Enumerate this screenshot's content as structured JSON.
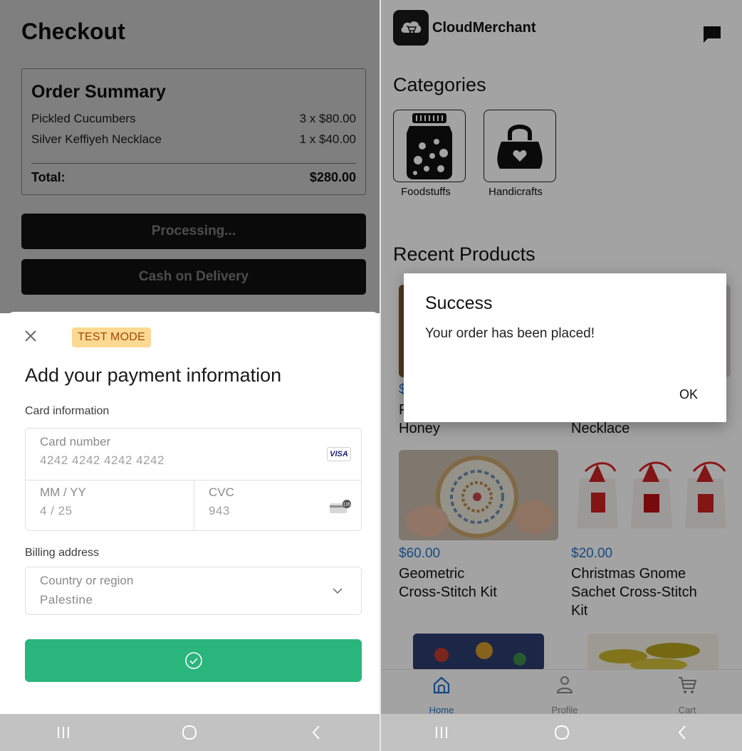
{
  "checkout": {
    "title": "Checkout",
    "summary": {
      "heading": "Order Summary",
      "items": [
        {
          "name": "Pickled Cucumbers",
          "qty_price": "3 x $80.00"
        },
        {
          "name": "Silver Keffiyeh Necklace",
          "qty_price": "1 x $40.00"
        }
      ],
      "total_label": "Total:",
      "total_value": "$280.00"
    },
    "processing_label": "Processing...",
    "cod_label": "Cash on Delivery"
  },
  "payment_sheet": {
    "close_icon": "close-icon",
    "badge": "TEST MODE",
    "title": "Add your payment information",
    "card_info_label": "Card information",
    "card_number_placeholder": "Card number",
    "card_number_value": "4242 4242 4242 4242",
    "card_brand": "VISA",
    "expiry_placeholder": "MM / YY",
    "expiry_value": "4 / 25",
    "cvc_placeholder": "CVC",
    "cvc_value": "943",
    "billing_label": "Billing address",
    "country_placeholder": "Country or region",
    "country_value": "Palestine",
    "pay_button_icon": "check-circle-icon",
    "accent_color": "#2ab57d",
    "badge_color": "#fbd992"
  },
  "store": {
    "app_name": "CloudMerchant",
    "categories_title": "Categories",
    "categories": [
      {
        "label": "Foodstuffs",
        "icon": "jar-icon"
      },
      {
        "label": "Handicrafts",
        "icon": "handbag-icon"
      }
    ],
    "recent_title": "Recent Products",
    "products": [
      {
        "price": "$",
        "name": "F\nHoney"
      },
      {
        "price": "",
        "name": "Necklace"
      },
      {
        "price": "$60.00",
        "name": "Geometric\nCross-Stitch Kit"
      },
      {
        "price": "$20.00",
        "name": "Christmas Gnome\nSachet Cross-Stitch\nKit"
      }
    ],
    "tabs": [
      {
        "label": "Home",
        "icon": "home-icon"
      },
      {
        "label": "Profile",
        "icon": "profile-icon"
      },
      {
        "label": "Cart",
        "icon": "cart-icon"
      }
    ],
    "price_color": "#2774c8"
  },
  "dialog": {
    "title": "Success",
    "message": "Your order has been placed!",
    "ok_label": "OK"
  },
  "system_nav": {
    "recents_icon": "recents-icon",
    "home_icon": "home-circle-icon",
    "back_icon": "back-icon"
  }
}
